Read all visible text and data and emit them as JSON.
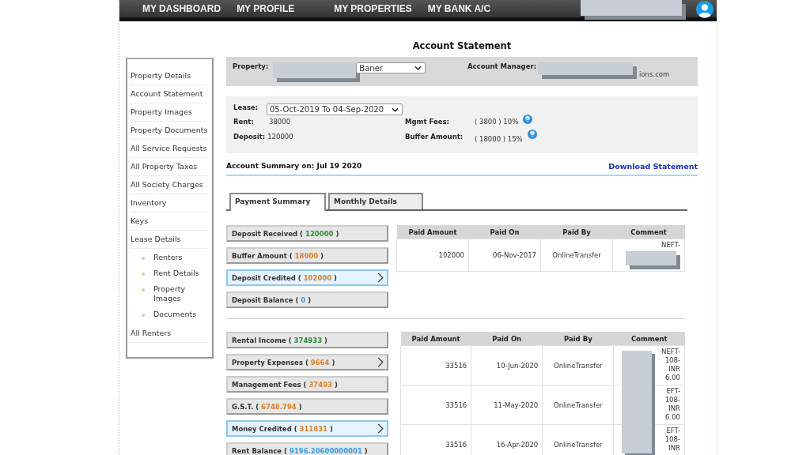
{
  "nav": {
    "items": [
      "MY DASHBOARD",
      "MY PROFILE",
      "MY PROPERTIES",
      "MY BANK A/C"
    ]
  },
  "page_title": "Account Statement",
  "sidebar": {
    "items": [
      {
        "label": "Property Details"
      },
      {
        "label": "Account Statement"
      },
      {
        "label": "Property Images"
      },
      {
        "label": "Property Documents"
      },
      {
        "label": "All Service Requests"
      },
      {
        "label": "All Property Taxes"
      },
      {
        "label": "All Society Charges"
      },
      {
        "label": "Inventory"
      },
      {
        "label": "Keys"
      },
      {
        "label": "Lease Details",
        "children": [
          {
            "label": "Renters"
          },
          {
            "label": "Rent Details"
          },
          {
            "label": "Property Images"
          },
          {
            "label": "Documents"
          }
        ]
      },
      {
        "label": "All Renters"
      }
    ]
  },
  "property_bar": {
    "property_label": "Property:",
    "property_value": "Baner",
    "manager_label": "Account Manager:",
    "manager_value": "ions.com"
  },
  "lease": {
    "lease_label": "Lease:",
    "lease_value": "05-Oct-2019 To 04-Sep-2020",
    "rent_label": "Rent:",
    "rent_value": "38000",
    "deposit_label": "Deposit:",
    "deposit_value": "120000",
    "fees_label": "Mgmt Fees:",
    "fees_value": "( 3800 ) 10%",
    "buffer_label": "Buffer Amount:",
    "buffer_value": "( 18000 ) 15%"
  },
  "summary_heading": "Account Summary on: Jul 19 2020",
  "download_link": "Download Statement",
  "tabs": [
    {
      "label": "Payment Summary",
      "selected": true
    },
    {
      "label": "Monthly Details",
      "selected": false
    }
  ],
  "sections": [
    {
      "items": [
        {
          "label": "Deposit Received (",
          "value": "120000",
          "close": ")",
          "color": "#2e8b3a",
          "selected": false,
          "has_details": false
        },
        {
          "label": "Buffer Amount (",
          "value": "18000",
          "close": ")",
          "color": "#d9822b",
          "selected": false,
          "has_details": false
        },
        {
          "label": "Deposit Credited (",
          "value": "102000",
          "close": ")",
          "color": "#d9822b",
          "selected": true,
          "has_details": true
        },
        {
          "label": "Deposit Balance (",
          "value": "0",
          "close": ")",
          "color": "#3b9be0",
          "selected": false,
          "has_details": false
        }
      ],
      "table": {
        "columns": [
          "Paid Amount",
          "Paid On",
          "Paid By",
          "Comment"
        ],
        "rows": [
          {
            "amount": "102000",
            "date": "06-Nov-2017",
            "method": "OnlineTransfer",
            "comment": [
              "NEFT-"
            ]
          }
        ]
      }
    },
    {
      "items": [
        {
          "label": "Rental Income (",
          "value": "374933",
          "close": ")",
          "color": "#2e8b3a",
          "selected": false,
          "has_details": false
        },
        {
          "label": "Property Expenses (",
          "value": "9664",
          "close": ")",
          "color": "#d9822b",
          "selected": false,
          "has_details": true
        },
        {
          "label": "Management Fees (",
          "value": "37493",
          "close": ")",
          "color": "#d9822b",
          "selected": false,
          "has_details": false
        },
        {
          "label": "G.S.T. (",
          "value": "6748.794",
          "close": ")",
          "color": "#d9822b",
          "selected": false,
          "has_details": false
        },
        {
          "label": "Money Credited (",
          "value": "311831",
          "close": ")",
          "color": "#d9822b",
          "selected": true,
          "has_details": true
        },
        {
          "label": "Rent Balance (",
          "value": "9196.20600000001",
          "close": ")",
          "color": "#3b9be0",
          "selected": false,
          "has_details": false
        }
      ],
      "table": {
        "columns": [
          "Paid Amount",
          "Paid On",
          "Paid By",
          "Comment"
        ],
        "rows": [
          {
            "amount": "33516",
            "date": "10-Jun-2020",
            "method": "OnlineTransfer",
            "comment": [
              "NEFT-",
              "108-",
              "INR",
              "6.00"
            ]
          },
          {
            "amount": "33516",
            "date": "11-May-2020",
            "method": "OnlineTransfer",
            "comment": [
              "EFT-",
              "108-",
              "INR",
              "6.00"
            ]
          },
          {
            "amount": "33516",
            "date": "16-Apr-2020",
            "method": "OnlineTransfer",
            "comment": [
              "EFT-",
              "108-",
              "INR"
            ]
          }
        ]
      }
    }
  ]
}
